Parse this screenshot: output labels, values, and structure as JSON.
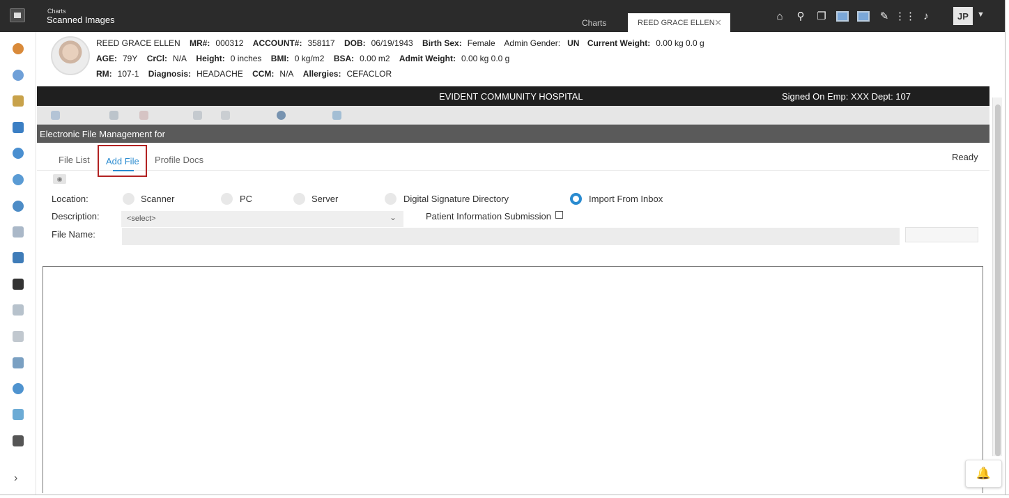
{
  "app": {
    "subtitle": "Charts",
    "title": "Scanned Images"
  },
  "tabs": {
    "charts": "Charts",
    "patient": "REED GRACE ELLEN",
    "close": "✕"
  },
  "user": {
    "initials": "JP"
  },
  "patient": {
    "name": "REED GRACE ELLEN",
    "mr_label": "MR#:",
    "mr": "000312",
    "account_label": "ACCOUNT#:",
    "account": "358117",
    "dob_label": "DOB:",
    "dob": "06/19/1943",
    "birth_sex_label": "Birth Sex:",
    "birth_sex": "Female",
    "admin_gender_label": "Admin Gender:",
    "admin_gender": "UN",
    "current_weight_label": "Current Weight:",
    "current_weight": "0.00 kg 0.0 g",
    "age_label": "AGE:",
    "age": "79Y",
    "crcl_label": "CrCl:",
    "crcl": "N/A",
    "height_label": "Height:",
    "height": "0 inches",
    "bmi_label": "BMI:",
    "bmi": "0 kg/m2",
    "bsa_label": "BSA:",
    "bsa": "0.00 m2",
    "admit_weight_label": "Admit Weight:",
    "admit_weight": "0.00 kg 0.0 g",
    "rm_label": "RM:",
    "rm": "107-1",
    "diagnosis_label": "Diagnosis:",
    "diagnosis": "HEADACHE",
    "ccm_label": "CCM:",
    "ccm": "N/A",
    "allergies_label": "Allergies:",
    "allergies": "CEFACLOR"
  },
  "hospital": {
    "name": "EVIDENT COMMUNITY HOSPITAL",
    "signed_on": "Signed On Emp: XXX Dept: 107"
  },
  "section": {
    "title": "Electronic File Management for"
  },
  "efm_tabs": {
    "file_list": "File List",
    "add_file": "Add File",
    "profile_docs": "Profile Docs",
    "status": "Ready"
  },
  "form": {
    "location_label": "Location:",
    "locations": [
      "Scanner",
      "PC",
      "Server",
      "Digital Signature Directory",
      "Import From Inbox"
    ],
    "selected_location": "Import From Inbox",
    "description_label": "Description:",
    "description_value": "<select>",
    "pis_label": "Patient Information Submission",
    "file_name_label": "File Name:",
    "file_name_value": ""
  },
  "colors": {
    "accent": "#2a8bd0",
    "highlight_border": "#b22222",
    "dark_bar": "#1f1f1f"
  }
}
